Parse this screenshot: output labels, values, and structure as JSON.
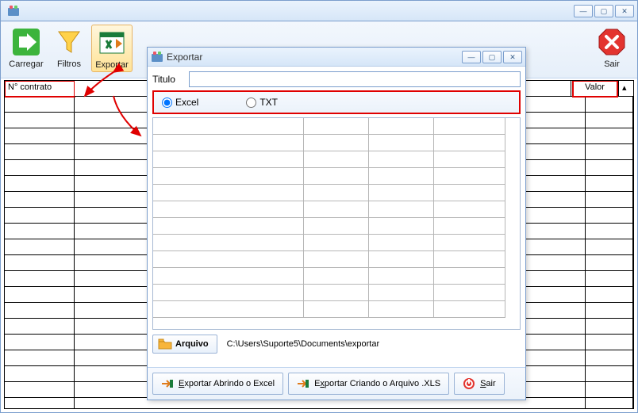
{
  "toolbar": {
    "carregar": "Carregar",
    "filtros": "Filtros",
    "exportar": "Exportar",
    "sair": "Sair"
  },
  "grid": {
    "columns": {
      "contrato": "N° contrato",
      "valor": "Valor"
    },
    "rows": 20
  },
  "exportDialog": {
    "title": "Exportar",
    "tituloLabel": "Titulo",
    "tituloValue": "",
    "formatExcel": "Excel",
    "formatTxt": "TXT",
    "formatSelected": "excel",
    "innerRows": 12,
    "arquivoBtn": "Arquivo",
    "arquivoPath": "C:\\Users\\Suporte5\\Documents\\exportar",
    "footer": {
      "exportarAbrindo": "Exportar Abrindo o Excel",
      "exportarCriando": "Exportar Criando o Arquivo .XLS",
      "sair": "Sair"
    }
  },
  "winControls": {
    "min": "—",
    "max": "▢",
    "close": "✕"
  }
}
